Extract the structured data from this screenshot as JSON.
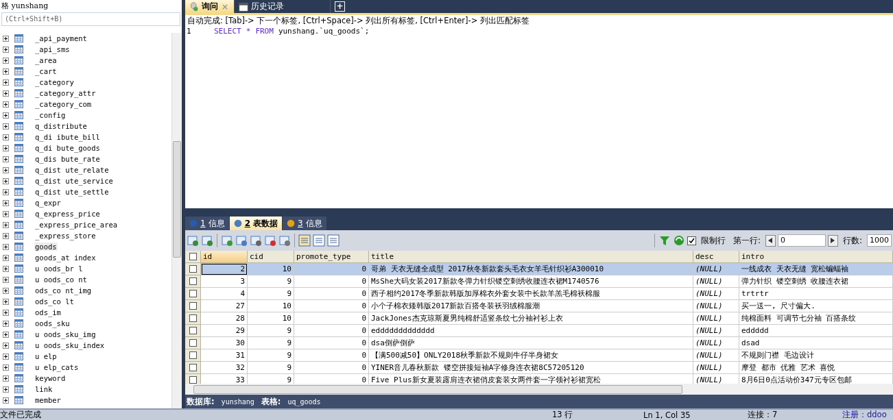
{
  "sidebar": {
    "title": "格 yunshang",
    "search_placeholder": "(Ctrl+Shift+B)",
    "items": [
      {
        "label": "_api_payment",
        "selected": false
      },
      {
        "label": "_api_sms",
        "selected": false
      },
      {
        "label": "_area",
        "selected": false
      },
      {
        "label": "_cart",
        "selected": false
      },
      {
        "label": "_category",
        "selected": false
      },
      {
        "label": "_category_attr",
        "selected": false
      },
      {
        "label": "_category_com",
        "selected": false
      },
      {
        "label": "_config",
        "selected": false
      },
      {
        "label": "q_distribute",
        "selected": false
      },
      {
        "label": "q_di  ibute_bill",
        "selected": false
      },
      {
        "label": "q_di  bute_goods",
        "selected": false
      },
      {
        "label": "q_dis  bute_rate",
        "selected": false
      },
      {
        "label": "q_dist  ute_relate",
        "selected": false
      },
      {
        "label": "q_dist  ute_service",
        "selected": false
      },
      {
        "label": "q_dist  ute_settle",
        "selected": false
      },
      {
        "label": "q_expr",
        "selected": false
      },
      {
        "label": "q_express_price",
        "selected": false
      },
      {
        "label": "_express_price_area",
        "selected": false
      },
      {
        "label": "_express_store",
        "selected": false
      },
      {
        "label": "goods",
        "selected": true
      },
      {
        "label": "goods_at  index",
        "selected": false
      },
      {
        "label": "u oods_br  l",
        "selected": false
      },
      {
        "label": "u oods_co  nt",
        "selected": false
      },
      {
        "label": "ods_co  nt_img",
        "selected": false
      },
      {
        "label": "ods_co  lt",
        "selected": false
      },
      {
        "label": "ods_im",
        "selected": false
      },
      {
        "label": "oods_sku",
        "selected": false
      },
      {
        "label": "u oods_sku_img",
        "selected": false
      },
      {
        "label": "u oods_sku_index",
        "selected": false
      },
      {
        "label": "u elp",
        "selected": false
      },
      {
        "label": "u elp_cats",
        "selected": false
      },
      {
        "label": "keyword",
        "selected": false
      },
      {
        "label": "link",
        "selected": false
      },
      {
        "label": "member",
        "selected": false
      }
    ]
  },
  "editor_tabs": [
    {
      "label": "询问",
      "selected": true,
      "close": "×"
    },
    {
      "label": "历史记录",
      "selected": false
    }
  ],
  "add_tab": "+",
  "hint": "自动完成: [Tab]-> 下一个标签, [Ctrl+Space]-> 列出所有标签, [Ctrl+Enter]-> 列出匹配标签",
  "editor": {
    "line_number": "1",
    "keywords": [
      "SELECT",
      "*",
      "FROM"
    ],
    "rest": "yunshang.`uq_goods`;"
  },
  "result_tabs": [
    {
      "number": "1",
      "label": "信息",
      "selected": false
    },
    {
      "number": "2",
      "label": "表数据",
      "selected": true
    },
    {
      "number": "3",
      "label": "信息",
      "selected": false
    }
  ],
  "toolbar": {
    "limit_checked": true,
    "limit_label": "限制行",
    "first_row_label": "第一行:",
    "first_row": "0",
    "rows_label": "行数:",
    "rows": "1000"
  },
  "table": {
    "all_selected": false,
    "columns": [
      "id",
      "cid",
      "promote_type",
      "title",
      "desc",
      "intro"
    ],
    "rows": [
      {
        "selected": true,
        "cells": [
          "2",
          "10",
          "0",
          "哥弟 天衣无缝全成型 2017秋冬新款套头毛衣女羊毛针织衫A300010",
          "(NULL)",
          "一线成衣 天衣无缝 宽松蝙蝠袖"
        ]
      },
      {
        "selected": false,
        "cells": [
          "3",
          "9",
          "0",
          "MsShe大码女装2017新款冬弹力针织镂空刺绣收腰连衣裙M1740576",
          "(NULL)",
          "弹力针织 镂空刺绣 收腰连衣裙"
        ]
      },
      {
        "selected": false,
        "cells": [
          "4",
          "9",
          "0",
          "西子相约2017冬季新款韩版加厚棉衣外套女装中长款羊羔毛棉袄棉服",
          "(NULL)",
          "trtrtr"
        ]
      },
      {
        "selected": false,
        "cells": [
          "27",
          "10",
          "0",
          "小个子棉衣矮韩版2017新款百搭冬装袄羽绒棉服潮",
          "(NULL)",
          "买一送一, 尺寸偏大."
        ]
      },
      {
        "selected": false,
        "cells": [
          "28",
          "10",
          "0",
          "JackJones杰克琼斯夏男纯棉舒适竖条纹七分袖衬衫上衣",
          "(NULL)",
          "纯棉面料 可调节七分袖 百搭条纹"
        ]
      },
      {
        "selected": false,
        "cells": [
          "29",
          "9",
          "0",
          "eddddddddddddd",
          "(NULL)",
          "eddddd"
        ]
      },
      {
        "selected": false,
        "cells": [
          "30",
          "9",
          "0",
          "dsa倒萨倒萨",
          "(NULL)",
          "dsad"
        ]
      },
      {
        "selected": false,
        "cells": [
          "31",
          "9",
          "0",
          "【满500减50】ONLY2018秋季新款不规则牛仔半身裙女",
          "(NULL)",
          "不规则门襟 毛边设计"
        ]
      },
      {
        "selected": false,
        "cells": [
          "32",
          "9",
          "0",
          "YINER音儿春秋新款 镂空拼接短袖A字修身连衣裙8C57205120",
          "(NULL)",
          "摩登 都市 优雅 艺术 喜悦"
        ]
      },
      {
        "selected": false,
        "cells": [
          "33",
          "9",
          "0",
          "Five Plus新女夏装露肩连衣裙俏皮套装女两件套一字领衬衫裙宽松",
          "(NULL)",
          "8月6日0点活动价347元专区包邮"
        ]
      }
    ]
  },
  "info_bar": {
    "db_label": "数据库:",
    "db": "yunshang",
    "table_label": "表格:",
    "table": "uq_goods"
  },
  "status_bar": {
    "left": "文件已完成",
    "rows": "13 行",
    "position": "Ln 1, Col 35",
    "connections": "连接：7",
    "register": "注册：ddoo"
  }
}
